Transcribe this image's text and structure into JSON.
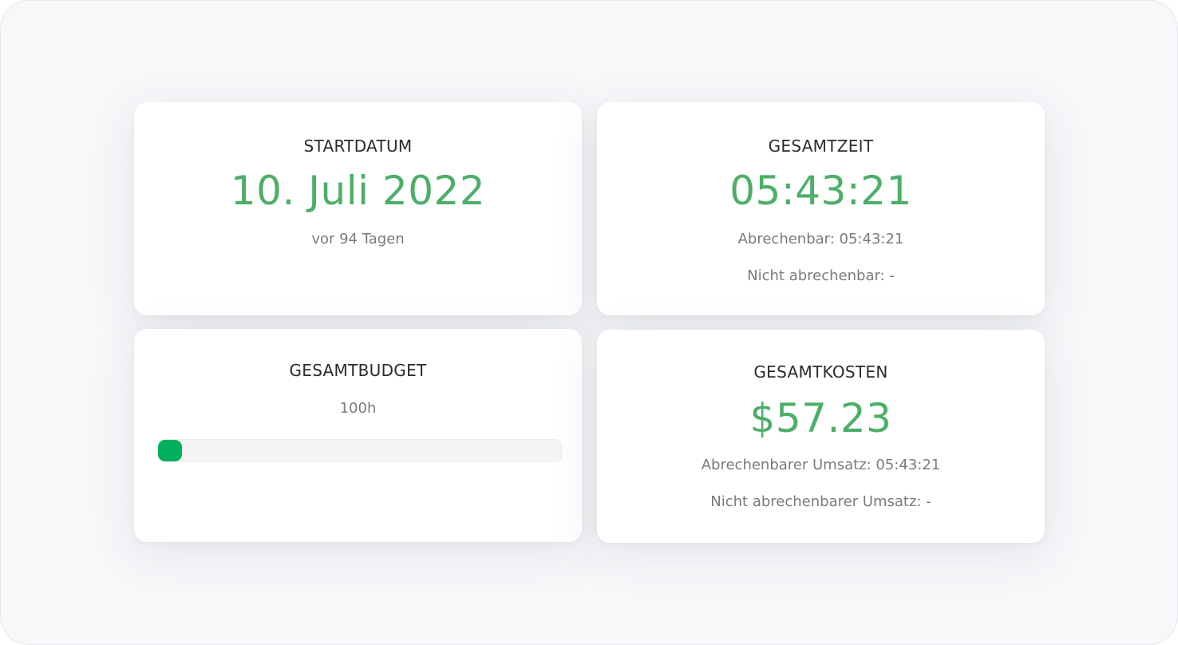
{
  "cards": {
    "start_date": {
      "title": "STARTDATUM",
      "value": "10. Juli 2022",
      "relative": "vor 94 Tagen"
    },
    "total_time": {
      "title": "GESAMTZEIT",
      "value": "05:43:21",
      "billable": "Abrechenbar: 05:43:21",
      "non_billable": "Nicht abrechenbar: -"
    },
    "total_budget": {
      "title": "GESAMTBUDGET",
      "budget": "100h",
      "progress_fraction": 0.06,
      "progress_color": "#00b05a"
    },
    "total_cost": {
      "title": "GESAMTKOSTEN",
      "value": "$57.23",
      "billable_revenue": "Abrechenbarer Umsatz: 05:43:21",
      "non_billable_revenue": "Nicht abrechenbarer Umsatz: -"
    }
  },
  "colors": {
    "accent": "#4caf68",
    "label": "#2b2b2b",
    "muted": "#7a7a7a"
  }
}
